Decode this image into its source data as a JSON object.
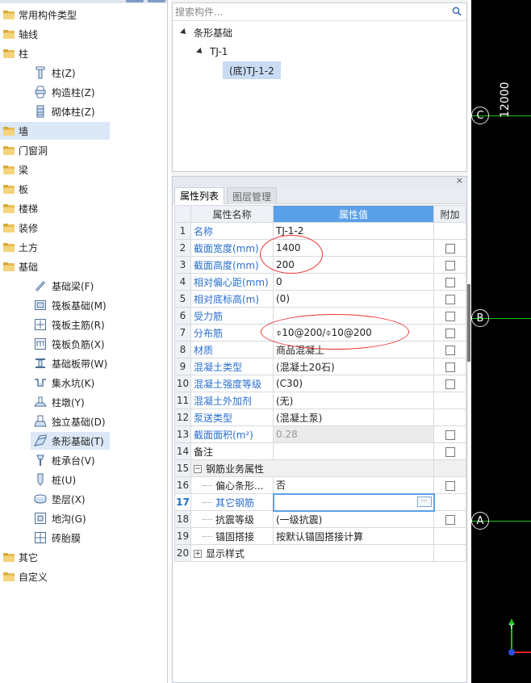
{
  "tree": {
    "groups": [
      {
        "label": "常用构件类型"
      },
      {
        "label": "轴线"
      },
      {
        "label": "柱"
      },
      {
        "label": "墙"
      },
      {
        "label": "门窗洞"
      },
      {
        "label": "梁"
      },
      {
        "label": "板"
      },
      {
        "label": "楼梯"
      },
      {
        "label": "装修"
      },
      {
        "label": "土方"
      },
      {
        "label": "基础"
      },
      {
        "label": "其它"
      },
      {
        "label": "自定义"
      }
    ],
    "column_items": [
      {
        "label": "柱(Z)",
        "icon": "column-icon"
      },
      {
        "label": "构造柱(Z)",
        "icon": "constructional-column-icon"
      },
      {
        "label": "砌体柱(Z)",
        "icon": "masonry-column-icon"
      }
    ],
    "foundation_items": [
      {
        "label": "基础梁(F)",
        "icon": "foundation-beam-icon"
      },
      {
        "label": "筏板基础(M)",
        "icon": "raft-foundation-icon"
      },
      {
        "label": "筏板主筋(R)",
        "icon": "raft-main-rebar-icon"
      },
      {
        "label": "筏板负筋(X)",
        "icon": "raft-negative-rebar-icon"
      },
      {
        "label": "基础板带(W)",
        "icon": "foundation-strip-icon"
      },
      {
        "label": "集水坑(K)",
        "icon": "sump-pit-icon"
      },
      {
        "label": "柱墩(Y)",
        "icon": "column-pier-icon"
      },
      {
        "label": "独立基础(D)",
        "icon": "isolated-foundation-icon"
      },
      {
        "label": "条形基础(T)",
        "icon": "strip-foundation-icon"
      },
      {
        "label": "桩承台(V)",
        "icon": "pile-cap-icon"
      },
      {
        "label": "桩(U)",
        "icon": "pile-icon"
      },
      {
        "label": "垫层(X)",
        "icon": "cushion-icon"
      },
      {
        "label": "地沟(G)",
        "icon": "trench-icon"
      },
      {
        "label": "砖胎膜",
        "icon": "brick-mold-icon"
      }
    ]
  },
  "search": {
    "placeholder": "搜索构件..."
  },
  "component_tree": {
    "root": "条形基础",
    "child": "TJ-1",
    "leaf": "(底)TJ-1-2"
  },
  "prop_panel": {
    "close": "×",
    "tabs": [
      "属性列表",
      "图层管理"
    ],
    "headers": {
      "num": "",
      "name": "属性名称",
      "value": "属性值",
      "add": "附加"
    },
    "rows": [
      {
        "n": "1",
        "name": "名称",
        "value": "TJ-1-2",
        "check": false
      },
      {
        "n": "2",
        "name": "截面宽度(mm)",
        "value": "1400",
        "check": true
      },
      {
        "n": "3",
        "name": "截面高度(mm)",
        "value": "200",
        "check": true
      },
      {
        "n": "4",
        "name": "相对偏心距(mm)",
        "value": "0",
        "check": true
      },
      {
        "n": "5",
        "name": "相对底标高(m)",
        "value": "(0)",
        "check": true
      },
      {
        "n": "6",
        "name": "受力筋",
        "value": "",
        "check": true
      },
      {
        "n": "7",
        "name": "分布筋",
        "value": "⌽10@200/⌽10@200",
        "check": true
      },
      {
        "n": "8",
        "name": "材质",
        "value": "商品混凝土",
        "check": true
      },
      {
        "n": "9",
        "name": "混凝土类型",
        "value": "(混凝土20石)",
        "check": true
      },
      {
        "n": "10",
        "name": "混凝土强度等级",
        "value": "(C30)",
        "check": true
      },
      {
        "n": "11",
        "name": "混凝土外加剂",
        "value": "(无)",
        "check": false
      },
      {
        "n": "12",
        "name": "泵送类型",
        "value": "(混凝土泵)",
        "check": false
      },
      {
        "n": "13",
        "name": "截面面积(m²)",
        "value": "0.28",
        "check": true
      },
      {
        "n": "14",
        "name": "备注",
        "value": "",
        "check": true
      },
      {
        "n": "15",
        "name": "钢筋业务属性",
        "value": "",
        "check": false
      },
      {
        "n": "16",
        "name": "偏心条形...",
        "value": "否",
        "check": true
      },
      {
        "n": "17",
        "name": "其它钢筋",
        "value": "",
        "check": false
      },
      {
        "n": "18",
        "name": "抗震等级",
        "value": "(一级抗震)",
        "check": true
      },
      {
        "n": "19",
        "name": "锚固搭接",
        "value": "按默认锚固搭接计算",
        "check": false
      },
      {
        "n": "20",
        "name": "显示样式",
        "value": "",
        "check": false
      }
    ],
    "expand_minus": "−",
    "expand_plus": "+",
    "edit_button": "···"
  },
  "canvas": {
    "axis_labels": [
      "C",
      "B",
      "A"
    ],
    "dimension": "12000",
    "axis_color": "#16c516",
    "y_axis_label": "Y"
  }
}
